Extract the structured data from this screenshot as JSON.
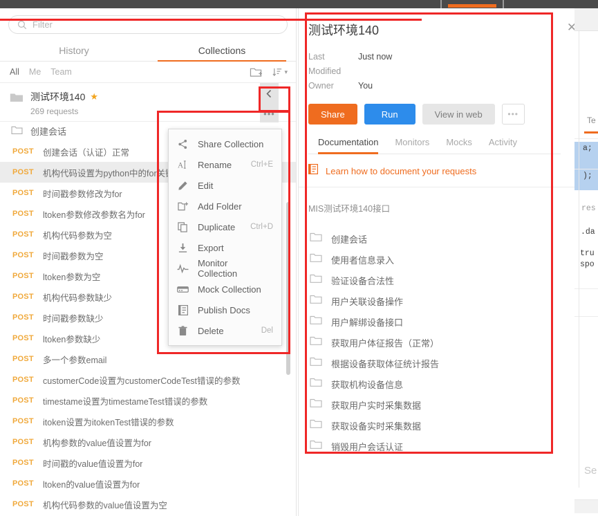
{
  "sidebar": {
    "filter": {
      "placeholder": "Filter",
      "value": "",
      "icon": "search-icon"
    },
    "tabs": [
      {
        "label": "History",
        "active": false
      },
      {
        "label": "Collections",
        "active": true
      }
    ],
    "scopes": [
      {
        "label": "All",
        "active": true
      },
      {
        "label": "Me",
        "active": false
      },
      {
        "label": "Team",
        "active": false
      }
    ],
    "toolbar_icons": [
      "new-folder-icon",
      "sort-icon",
      "chevron-down-icon"
    ],
    "collection": {
      "name": "测试环境140",
      "starred": true,
      "requests_count": "269 requests",
      "collapse_icon": "chevron-left-icon",
      "more_icon": "more-horizontal-icon"
    },
    "folder_row": {
      "label": "创建会话",
      "icon": "folder-icon"
    },
    "requests": [
      {
        "method": "POST",
        "name": "创建会话（认证）正常",
        "selected": false
      },
      {
        "method": "POST",
        "name": "机构代码设置为python中的for关键字",
        "selected": true
      },
      {
        "method": "POST",
        "name": "时间戳参数修改为for",
        "selected": false
      },
      {
        "method": "POST",
        "name": "ltoken参数修改参数名为for",
        "selected": false
      },
      {
        "method": "POST",
        "name": "机构代码参数为空",
        "selected": false
      },
      {
        "method": "POST",
        "name": "时间戳参数为空",
        "selected": false
      },
      {
        "method": "POST",
        "name": "ltoken参数为空",
        "selected": false
      },
      {
        "method": "POST",
        "name": "机构代码参数缺少",
        "selected": false
      },
      {
        "method": "POST",
        "name": "时间戳参数缺少",
        "selected": false
      },
      {
        "method": "POST",
        "name": "ltoken参数缺少",
        "selected": false
      },
      {
        "method": "POST",
        "name": "多一个参数email",
        "selected": false
      },
      {
        "method": "POST",
        "name": "customerCode设置为customerCodeTest错误的参数",
        "selected": false
      },
      {
        "method": "POST",
        "name": "timestame设置为timestameTest错误的参数",
        "selected": false
      },
      {
        "method": "POST",
        "name": "itoken设置为itokenTest错误的参数",
        "selected": false
      },
      {
        "method": "POST",
        "name": "机构参数的value值设置为for",
        "selected": false
      },
      {
        "method": "POST",
        "name": "时间戳的value值设置为for",
        "selected": false
      },
      {
        "method": "POST",
        "name": "ltoken的value值设置为for",
        "selected": false
      },
      {
        "method": "POST",
        "name": "机构代码参数的value值设置为空",
        "selected": false
      }
    ]
  },
  "context_menu": {
    "items": [
      {
        "label": "Share Collection",
        "shortcut": "",
        "icon": "share-icon"
      },
      {
        "label": "Rename",
        "shortcut": "Ctrl+E",
        "icon": "text-cursor-icon"
      },
      {
        "label": "Edit",
        "shortcut": "",
        "icon": "pencil-icon"
      },
      {
        "label": "Add Folder",
        "shortcut": "",
        "icon": "folder-plus-icon"
      },
      {
        "label": "Duplicate",
        "shortcut": "Ctrl+D",
        "icon": "copy-icon"
      },
      {
        "label": "Export",
        "shortcut": "",
        "icon": "download-icon"
      },
      {
        "label": "Monitor Collection",
        "shortcut": "",
        "icon": "activity-icon"
      },
      {
        "label": "Mock Collection",
        "shortcut": "",
        "icon": "server-icon"
      },
      {
        "label": "Publish Docs",
        "shortcut": "",
        "icon": "document-icon"
      },
      {
        "label": "Delete",
        "shortcut": "Del",
        "icon": "trash-icon"
      }
    ]
  },
  "detail": {
    "title": "测试环境140",
    "close_icon": "close-icon",
    "meta": [
      {
        "key": "Last Modified",
        "value": "Just now"
      },
      {
        "key": "Owner",
        "value": "You"
      }
    ],
    "buttons": [
      {
        "label": "Share",
        "style": "primary-orange"
      },
      {
        "label": "Run",
        "style": "primary-blue"
      },
      {
        "label": "View in web",
        "style": "muted"
      },
      {
        "label": "•••",
        "style": "ghost"
      }
    ],
    "tabs": [
      {
        "label": "Documentation",
        "active": true
      },
      {
        "label": "Monitors",
        "active": false
      },
      {
        "label": "Mocks",
        "active": false
      },
      {
        "label": "Activity",
        "active": false
      }
    ],
    "learn_link": "Learn how to document your requests",
    "learn_icon": "doc-orange-icon",
    "description": "MIS测试环境140接口",
    "folders": [
      "创建会话",
      "使用者信息录入",
      "验证设备合法性",
      "用户关联设备操作",
      "用户解绑设备接口",
      "获取用户体征报告（正常）",
      "根据设备获取体征统计报告",
      "获取机构设备信息",
      "获取用户实时采集数据",
      "获取设备实时采集数据",
      "销毁用户会话认证"
    ]
  },
  "background_editor": {
    "tab_label": "Te",
    "code_lines": [
      "a;",
      ");",
      "res",
      ".da",
      "tru",
      "spo"
    ],
    "bottom_label": "Se"
  },
  "colors": {
    "accent_orange": "#ef6c1f",
    "accent_blue": "#2d8ceb",
    "method_post": "#f0a93c",
    "annotation_red": "#ef2727",
    "selection_blue": "#b6d1ef",
    "topbar_dark": "#4a4a4a"
  }
}
